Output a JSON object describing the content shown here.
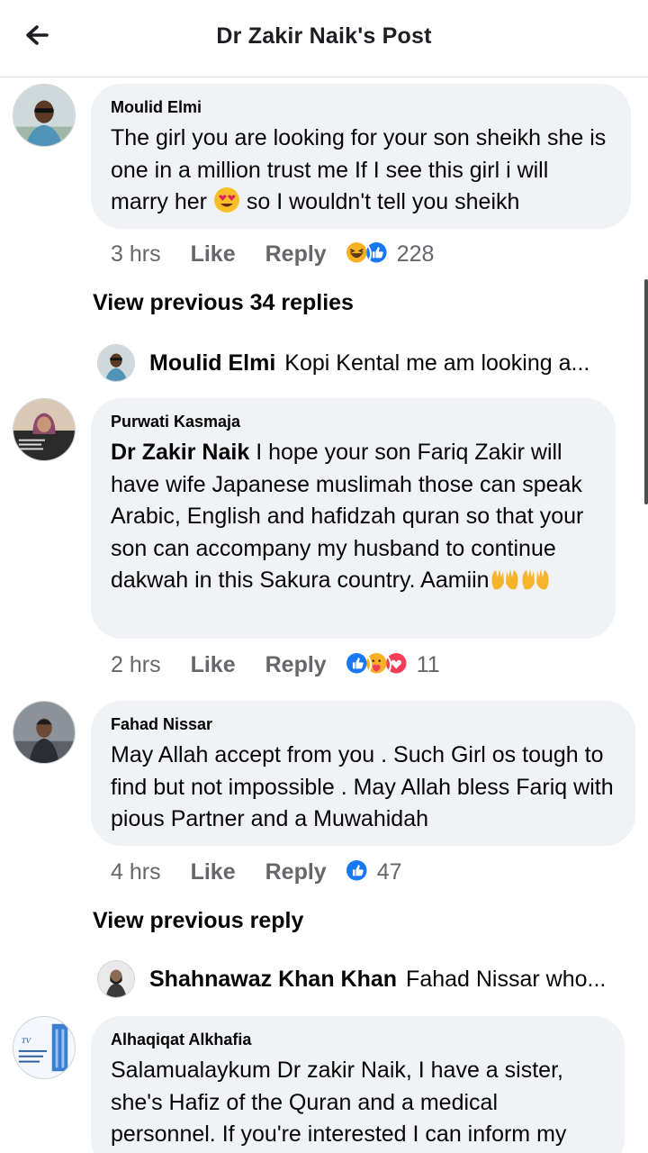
{
  "header": {
    "title": "Dr Zakir Naik's Post"
  },
  "comments": [
    {
      "author": "Moulid Elmi",
      "text": "The girl you are looking for your son  sheikh she is one in a million  trust me If I see this girl i will marry her",
      "text_after_emoji": " so I wouldn't tell you sheikh",
      "time": "3 hrs",
      "like": "Like",
      "reply": "Reply",
      "reaction_count": "228",
      "reactions": [
        "haha-icon",
        "like-icon"
      ]
    },
    {
      "author": "Purwati Kasmaja",
      "mention": "Dr Zakir Naik",
      "text": " I hope your son Fariq Zakir will have wife Japanese muslimah  those can speak Arabic, English and hafidzah quran so that your son can accompany my husband to continue dakwah in this Sakura country. Aamiin",
      "time": "2 hrs",
      "like": "Like",
      "reply": "Reply",
      "reaction_count": "11",
      "reactions": [
        "like-icon",
        "care-icon",
        "love-icon"
      ]
    },
    {
      "author": "Fahad Nissar",
      "text": "May Allah accept from you . Such Girl os tough to find but not impossible . May Allah bless Fariq with pious Partner and a Muwahidah",
      "time": "4 hrs",
      "like": "Like",
      "reply": "Reply",
      "reaction_count": "47",
      "reactions": [
        "like-icon"
      ]
    },
    {
      "author": "Alhaqiqat Alkhafia",
      "text": "Salamualaykum Dr zakir Naik, I have a sister, she's Hafiz of the Quran and a medical personnel. If you're interested I can inform my"
    }
  ],
  "view_previous_1": "View previous 34 replies",
  "reply_preview_1": {
    "name": "Moulid Elmi",
    "text": "Kopi Kental me am looking a..."
  },
  "view_previous_2": "View previous reply",
  "reply_preview_2": {
    "name": "Shahnawaz Khan Khan",
    "text": "Fahad Nissar who..."
  },
  "colors": {
    "like": "#1877f2",
    "love": "#f33e58",
    "haha": "#f7b125",
    "bubble": "#f0f2f5",
    "meta": "#65676b"
  }
}
